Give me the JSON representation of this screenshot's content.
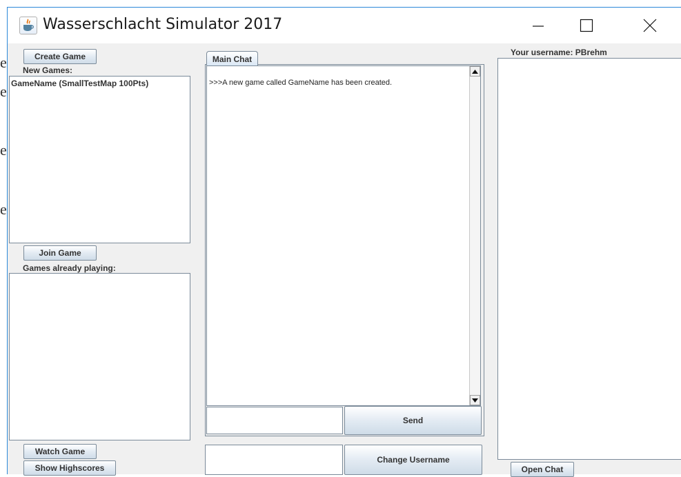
{
  "window": {
    "title": "Wasserschlacht Simulator 2017"
  },
  "background_fragments": [
    "e",
    "e",
    "e",
    "e"
  ],
  "left": {
    "create_game": "Create Game",
    "new_games_label": "New Games:",
    "new_games": [
      "GameName (SmallTestMap 100Pts)"
    ],
    "join_game": "Join Game",
    "playing_label": "Games already playing:",
    "playing_games": [],
    "watch_game": "Watch Game",
    "show_highscores": "Show Highscores"
  },
  "center": {
    "tab_label": "Main Chat",
    "messages": [
      ">>>A new game called GameName has been created."
    ],
    "message_input_value": "",
    "send": "Send",
    "username_input_value": "",
    "change_username": "Change Username"
  },
  "right": {
    "username_label": "Your username: PBrehm",
    "open_chat": "Open Chat"
  }
}
